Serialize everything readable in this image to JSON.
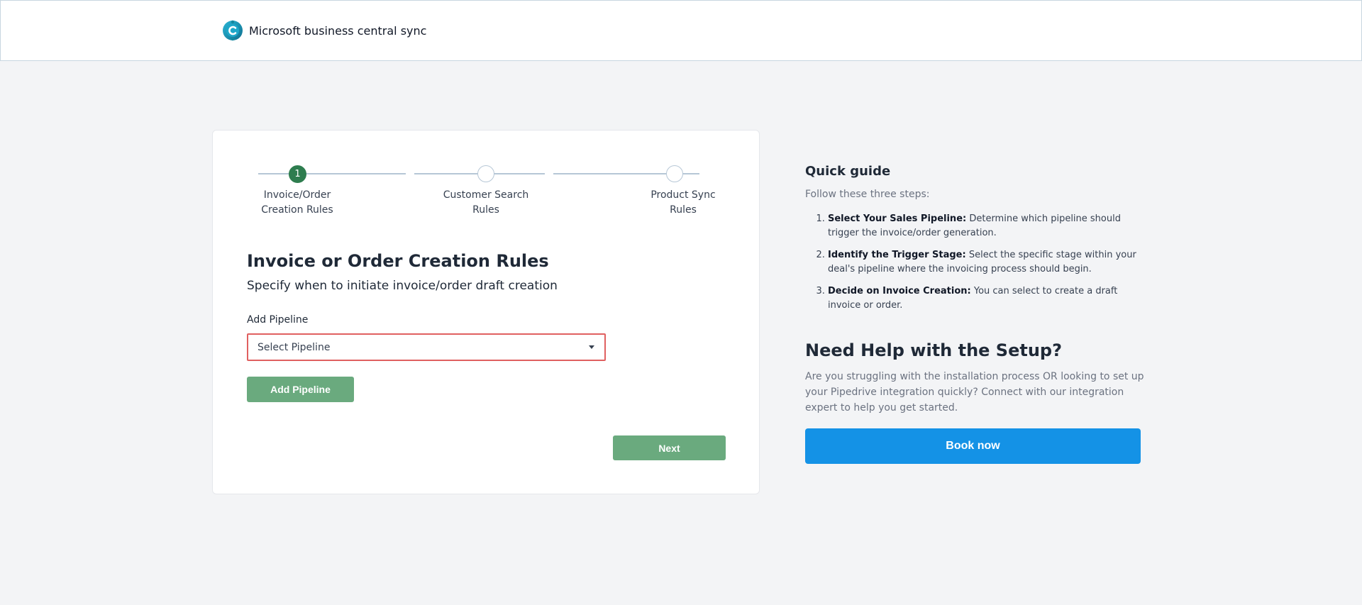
{
  "header": {
    "app_name": "Microsoft business central sync",
    "logo_icon": "business-central-logo-icon"
  },
  "stepper": {
    "steps": [
      {
        "number": "1",
        "label": "Invoice/Order\nCreation Rules",
        "state": "active"
      },
      {
        "number": "",
        "label": "Customer Search\nRules",
        "state": "pending"
      },
      {
        "number": "",
        "label": "Product Sync\nRules",
        "state": "pending"
      }
    ]
  },
  "form": {
    "title": "Invoice or Order Creation Rules",
    "subtitle": "Specify when to initiate invoice/order draft creation",
    "pipeline_label": "Add Pipeline",
    "pipeline_select_value": "Select Pipeline",
    "add_pipeline_button": "Add Pipeline",
    "next_button": "Next"
  },
  "guide": {
    "title": "Quick guide",
    "intro": "Follow these three steps:",
    "steps": [
      {
        "heading": "Select Your Sales Pipeline:",
        "text": " Determine which pipeline should trigger the invoice/order generation."
      },
      {
        "heading": "Identify the Trigger Stage:",
        "text": " Select the specific stage within your deal's pipeline where the invoicing process should begin."
      },
      {
        "heading": "Decide on Invoice Creation:",
        "text": " You can select to create a draft invoice or order."
      }
    ]
  },
  "help": {
    "title": "Need Help with the Setup?",
    "text": "Are you struggling with the installation process OR looking to set up your Pipedrive integration quickly? Connect with our integration expert to help you get started.",
    "book_button": "Book now"
  },
  "colors": {
    "active_step": "#2e7d4f",
    "green_button": "#6aaa7e",
    "book_button": "#1492e6",
    "select_border": "#e06060"
  }
}
